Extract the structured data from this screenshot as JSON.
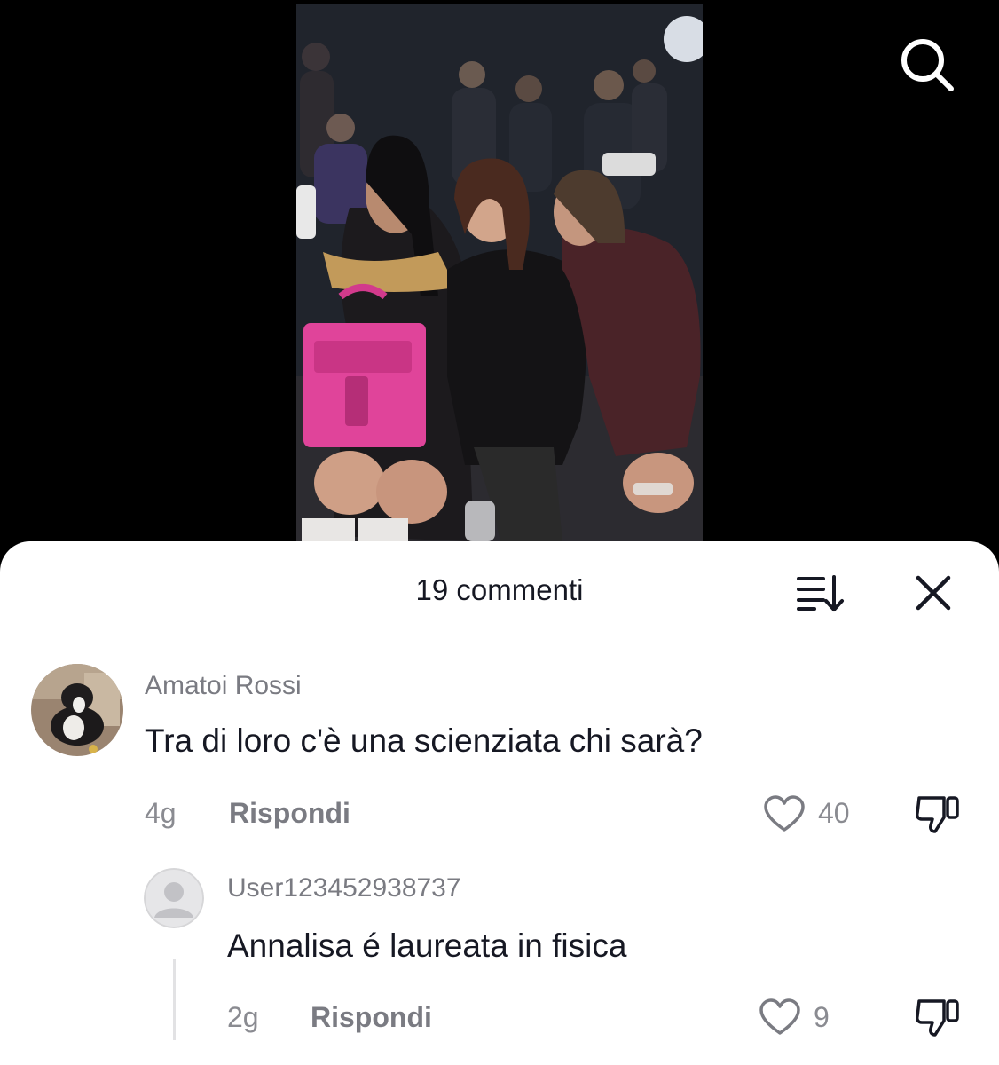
{
  "header": {
    "comments_count_label": "19 commenti",
    "icons": {
      "search": "search-icon",
      "sort": "sort-icon",
      "close": "close-icon"
    }
  },
  "comments": [
    {
      "username": "Amatoi Rossi",
      "text": "Tra di loro c'è una scienziata chi sarà?",
      "time": "4g",
      "reply_label": "Rispondi",
      "likes": "40"
    }
  ],
  "replies": [
    {
      "username": "User123452938737",
      "text": "Annalisa é laureata in fisica",
      "time": "2g",
      "reply_label": "Rispondi",
      "likes": "9"
    }
  ],
  "colors": {
    "sheet_bg": "#ffffff",
    "text_primary": "#161823",
    "text_secondary": "#7a7b82",
    "video_bg": "#000000",
    "bag_pink": "#e0449a"
  }
}
